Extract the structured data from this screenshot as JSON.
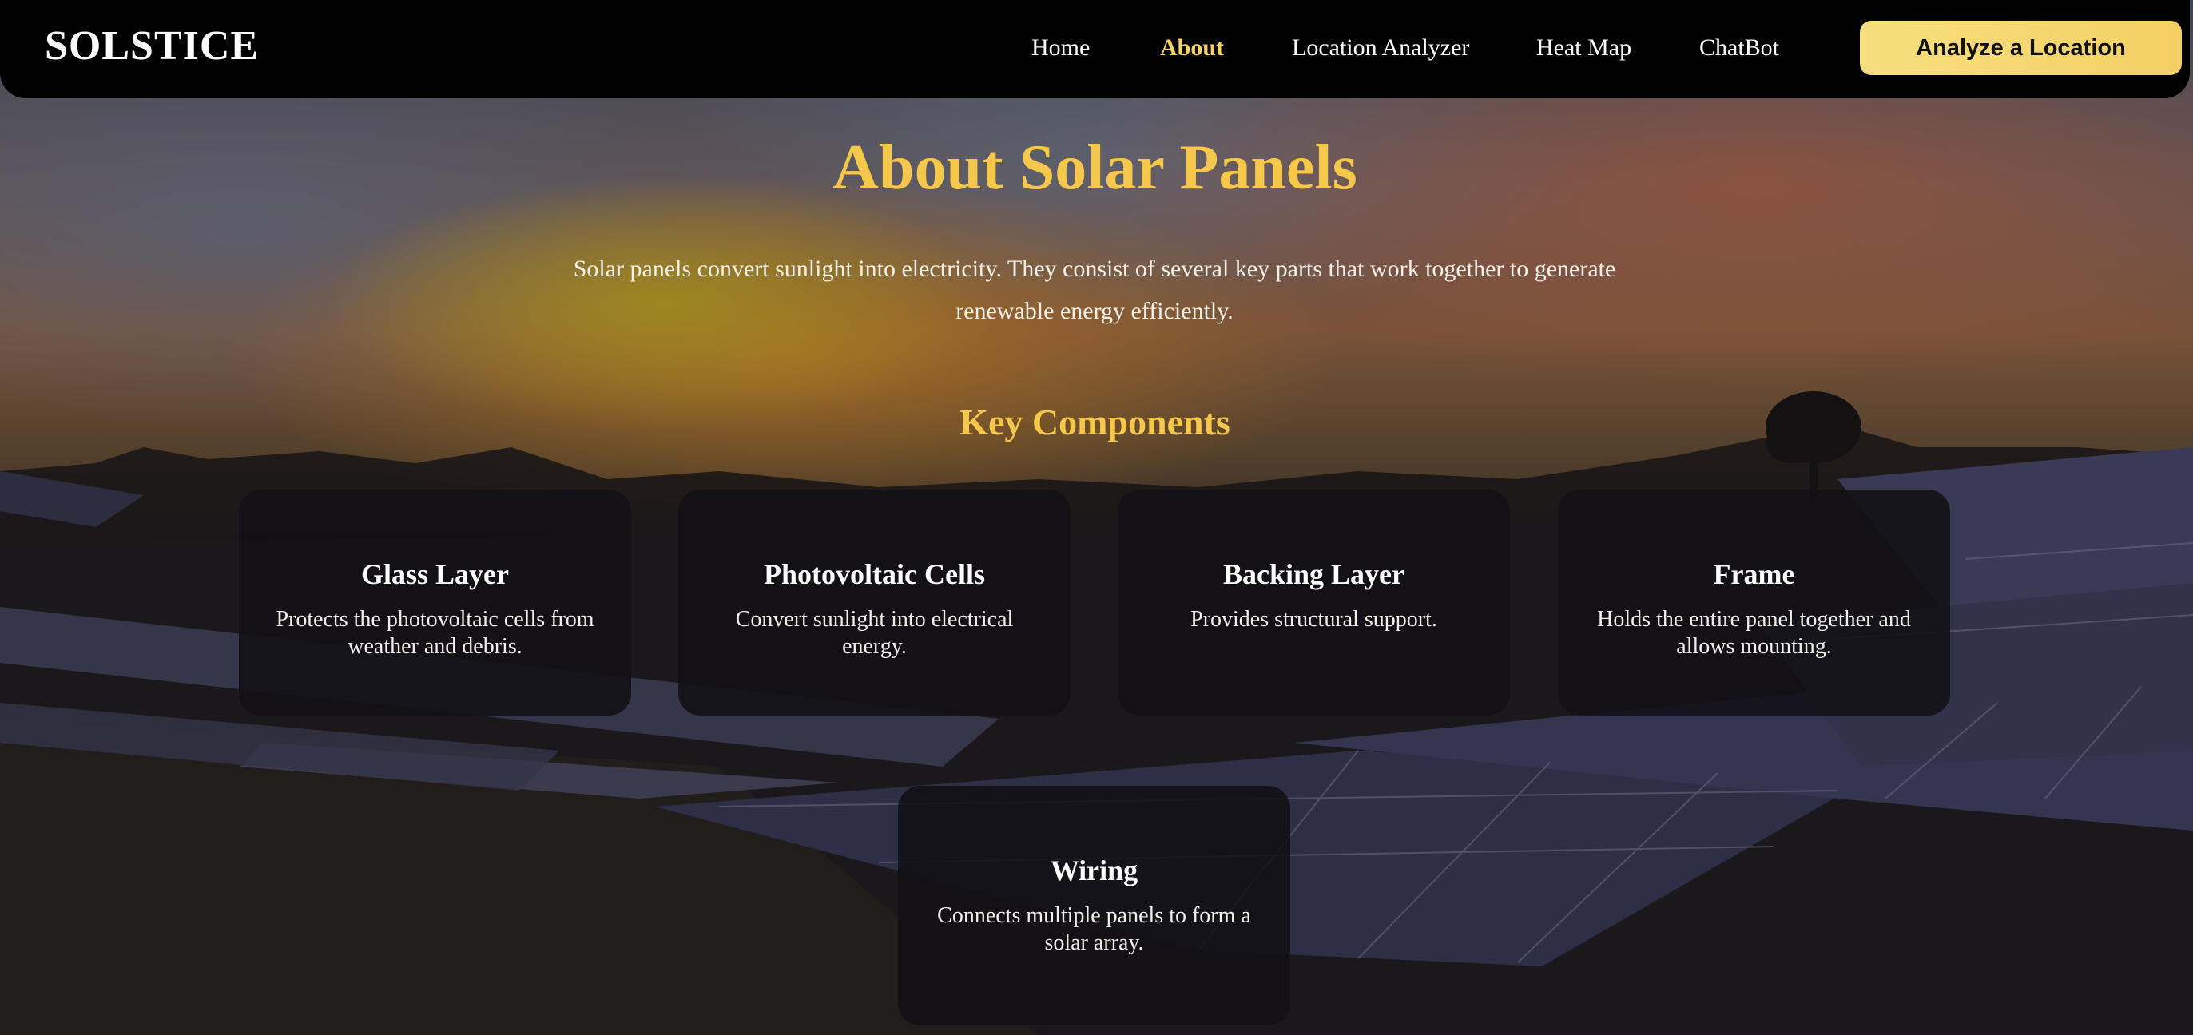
{
  "navbar": {
    "brand": "SOLSTICE",
    "links": [
      {
        "label": "Home",
        "active": false
      },
      {
        "label": "About",
        "active": true
      },
      {
        "label": "Location Analyzer",
        "active": false
      },
      {
        "label": "Heat Map",
        "active": false
      },
      {
        "label": "ChatBot",
        "active": false
      }
    ],
    "cta_label": "Analyze a Location"
  },
  "main": {
    "title": "About Solar Panels",
    "intro": "Solar panels convert sunlight into electricity. They consist of several key parts that work together to generate renewable energy efficiently.",
    "section_title": "Key Components",
    "components": [
      {
        "title": "Glass Layer",
        "description": "Protects the photovoltaic cells from weather and debris."
      },
      {
        "title": "Photovoltaic Cells",
        "description": "Convert sunlight into electrical energy."
      },
      {
        "title": "Backing Layer",
        "description": "Provides structural support."
      },
      {
        "title": "Frame",
        "description": "Holds the entire panel together and allows mounting."
      },
      {
        "title": "Wiring",
        "description": "Connects multiple panels to form a solar array."
      }
    ]
  },
  "colors": {
    "accent": "#f5c84c",
    "nav_active": "#f6d365",
    "cta_background": "#f4d063",
    "navbar_background": "#000000",
    "card_background": "#121014"
  }
}
